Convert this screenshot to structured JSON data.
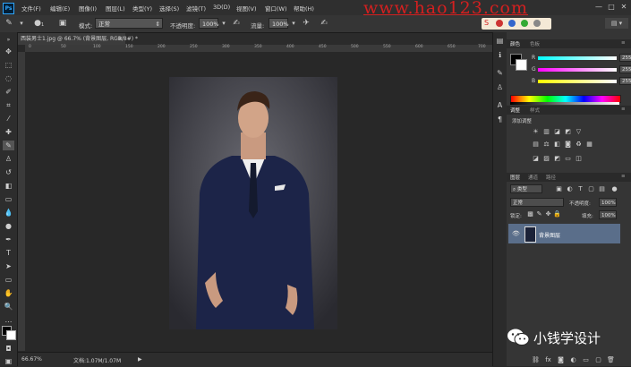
{
  "app": {
    "logo": "Ps"
  },
  "menubar": {
    "items": [
      "文件(F)",
      "编辑(E)",
      "图像(I)",
      "图层(L)",
      "类型(Y)",
      "选择(S)",
      "滤镜(T)",
      "3D(D)",
      "视图(V)",
      "窗口(W)",
      "帮助(H)"
    ],
    "window_buttons": [
      "—",
      "□",
      "✕"
    ]
  },
  "watermark": "www.hao123.com",
  "options": {
    "mode_label": "模式:",
    "mode_value": "正常",
    "opacity_label": "不透明度:",
    "opacity_value": "100%",
    "flow_label": "流量:",
    "flow_value": "100%",
    "brush_size": "1"
  },
  "document": {
    "tab_label": "西装男士1.jpg @ 66.7% (背景图层, RGB/8#) *",
    "zoom": "66.67%",
    "doc_info": "文档:1.07M/1.07M",
    "ruler_ticks": [
      "0",
      "50",
      "100",
      "150",
      "200",
      "250",
      "300",
      "350",
      "400",
      "450",
      "500",
      "550",
      "600",
      "650",
      "700"
    ]
  },
  "color_panel": {
    "tabs": [
      "颜色",
      "色板"
    ],
    "channels": [
      {
        "label": "R",
        "value": "255",
        "gradient": "linear-gradient(to right,#00ffff,#ffffff)"
      },
      {
        "label": "G",
        "value": "255",
        "gradient": "linear-gradient(to right,#ff00ff,#ffffff)"
      },
      {
        "label": "B",
        "value": "255",
        "gradient": "linear-gradient(to right,#ffff00,#ffffff)"
      }
    ]
  },
  "adjustments_panel": {
    "tabs": [
      "调整",
      "样式"
    ],
    "add_label": "添加调整"
  },
  "layers_panel": {
    "tabs": [
      "图层",
      "通道",
      "路径"
    ],
    "filter_value": "类型",
    "blend_mode": "正常",
    "opacity_label": "不透明度:",
    "opacity_value": "100%",
    "lock_label": "锁定:",
    "fill_label": "填充:",
    "fill_value": "100%",
    "layer_name": "背景图层"
  },
  "wechat": {
    "account": "小钱学设计"
  },
  "colors": {
    "accent": "#31a8ff",
    "layer_selected": "#5a6e8a",
    "watermark": "#d32020"
  }
}
